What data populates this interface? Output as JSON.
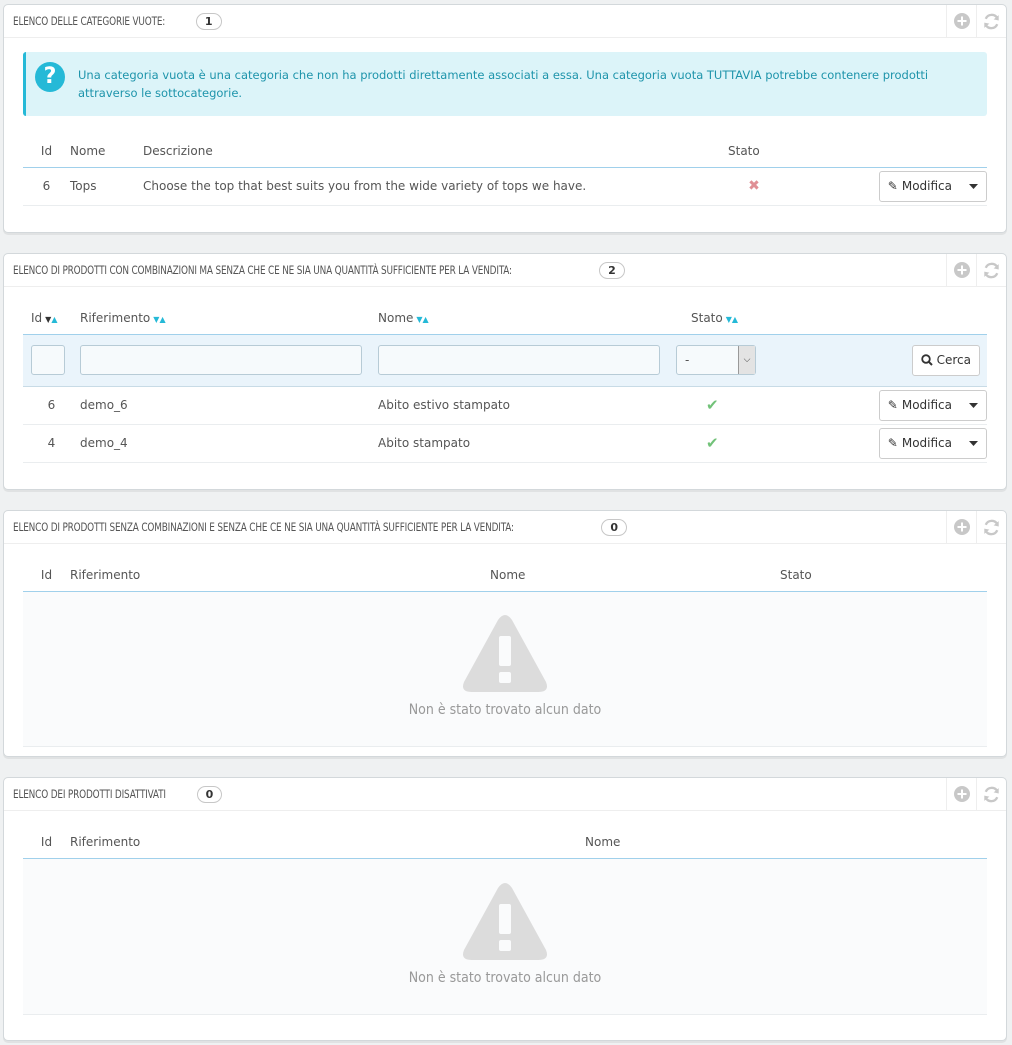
{
  "panel1": {
    "title": "ELENCO DELLE CATEGORIE VUOTE:",
    "count": "1",
    "info": "Una categoria vuota è una categoria che non ha prodotti direttamente associati a essa. Una categoria vuota TUTTAVIA potrebbe contenere prodotti attraverso le sottocategorie.",
    "headers": {
      "id": "Id",
      "name": "Nome",
      "desc": "Descrizione",
      "status": "Stato"
    },
    "rows": [
      {
        "id": "6",
        "name": "Tops",
        "desc": "Choose the top that best suits you from the wide variety of tops we have.",
        "status": "disabled",
        "action": "Modifica"
      }
    ]
  },
  "panel2": {
    "title": "ELENCO DI PRODOTTI CON COMBINAZIONI MA SENZA CHE CE NE SIA UNA QUANTITÀ SUFFICIENTE PER LA VENDITA:",
    "count": "2",
    "headers": {
      "id": "Id",
      "ref": "Riferimento",
      "name": "Nome",
      "status": "Stato"
    },
    "filter": {
      "status_value": "-",
      "search_label": "Cerca"
    },
    "rows": [
      {
        "id": "6",
        "ref": "demo_6",
        "name": "Abito estivo stampato",
        "status": "enabled",
        "action": "Modifica"
      },
      {
        "id": "4",
        "ref": "demo_4",
        "name": "Abito stampato",
        "status": "enabled",
        "action": "Modifica"
      }
    ]
  },
  "panel3": {
    "title": "ELENCO DI PRODOTTI SENZA COMBINAZIONI E SENZA CHE CE NE SIA UNA QUANTITÀ SUFFICIENTE PER LA VENDITA:",
    "count": "0",
    "headers": {
      "id": "Id",
      "ref": "Riferimento",
      "name": "Nome",
      "status": "Stato"
    },
    "empty": "Non è stato trovato alcun dato"
  },
  "panel4": {
    "title": "ELENCO DEI PRODOTTI DISATTIVATI",
    "count": "0",
    "headers": {
      "id": "Id",
      "ref": "Riferimento",
      "name": "Nome"
    },
    "empty": "Non è stato trovato alcun dato"
  },
  "icons": {
    "add": "plus-circle-icon",
    "refresh": "refresh-icon",
    "info": "question-icon",
    "edit": "pencil-icon",
    "caret": "caret-down-icon",
    "search": "search-icon",
    "enabled": "check-icon",
    "disabled": "cross-icon",
    "warning": "warning-icon"
  },
  "colors": {
    "accent": "#25b9d7",
    "ok": "#72c279",
    "ko": "#e08f95",
    "info_bg": "#dcf4f9"
  }
}
